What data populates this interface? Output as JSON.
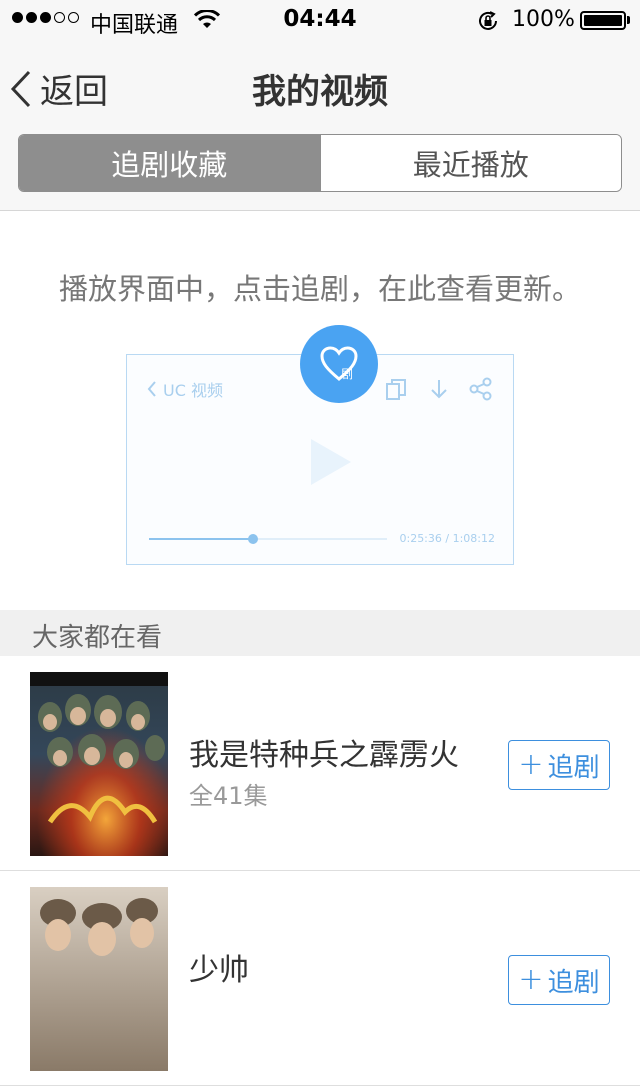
{
  "status_bar": {
    "carrier": "中国联通",
    "time": "04:44",
    "battery": "100%",
    "signal_bars_filled": 3,
    "signal_bars_total": 5
  },
  "nav": {
    "back_label": "返回",
    "title": "我的视频"
  },
  "tabs": [
    {
      "label": "追剧收藏",
      "active": true
    },
    {
      "label": "最近播放",
      "active": false
    }
  ],
  "hint": "播放界面中，点击追剧，在此查看更新。",
  "player_demo": {
    "source_label": "UC 视频",
    "fav_badge": "剧",
    "time": "0:25:36 / 1:08:12",
    "progress": 0.435
  },
  "section_title": "大家都在看",
  "shows": [
    {
      "title": "我是特种兵之霹雳火",
      "episodes": "全41集",
      "button": "追剧"
    },
    {
      "title": "少帅",
      "episodes": "",
      "button": "追剧"
    }
  ],
  "colors": {
    "accent": "#3d8fde",
    "fav_circle": "#4aa3f2",
    "segment_active": "#8e8e8e"
  }
}
